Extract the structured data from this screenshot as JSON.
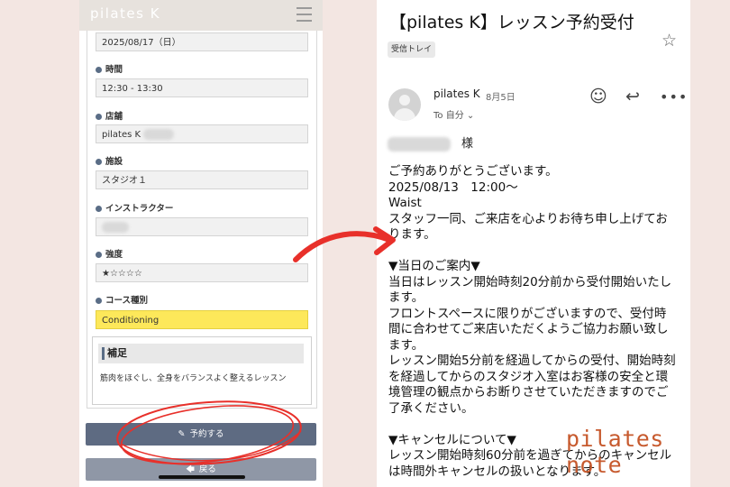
{
  "phone": {
    "brand": "pilates K",
    "fields": [
      {
        "label": "",
        "value": "2025/08/17（日）"
      },
      {
        "label": "時間",
        "value": "12:30 - 13:30"
      },
      {
        "label": "店舗",
        "value": "pilates K"
      },
      {
        "label": "施設",
        "value": "スタジオ１"
      },
      {
        "label": "インストラクター",
        "value": ""
      },
      {
        "label": "強度",
        "value": "★☆☆☆☆"
      },
      {
        "label": "コース種別",
        "value": "Conditioning"
      }
    ],
    "supplement": {
      "title": "補足",
      "text": "筋肉をほぐし、全身をバランスよく整えるレッスン"
    },
    "reserve_button": "予約する",
    "back_button": "戻る"
  },
  "email": {
    "subject": "【pilates K】レッスン予約受付",
    "label": "受信トレイ",
    "sender": "pilates K",
    "date": "8月5日",
    "to": "To 自分",
    "recipient_suffix": "様",
    "body_lines": [
      "ご予約ありがとうございます。",
      "2025/08/13　12:00〜",
      "Waist",
      "スタッフ一同、ご来店を心よりお待ち申し上げてお",
      "ります。",
      "",
      "▼当日のご案内▼",
      "当日はレッスン開始時刻20分前から受付開始いたし",
      "ます。",
      "フロントスペースに限りがございますので、受付時",
      "間に合わせてご来店いただくようご協力お願い致し",
      "ます。",
      "レッスン開始5分前を経過してからの受付、開始時刻",
      "を経過してからのスタジオ入室はお客様の安全と環",
      "境管理の観点からお断りさせていただきますのでご",
      "了承ください。",
      "",
      "▼キャンセルについて▼",
      "レッスン開始時刻60分前を過ぎてからのキャンセル",
      "は時間外キャンセルの扱いとなります。"
    ]
  },
  "watermark": "pilates note",
  "colors": {
    "background": "#f3e6e2",
    "button": "#5e6b82",
    "highlight": "#fde85a",
    "annotation": "#e8302a",
    "watermark": "#c75a2e"
  }
}
